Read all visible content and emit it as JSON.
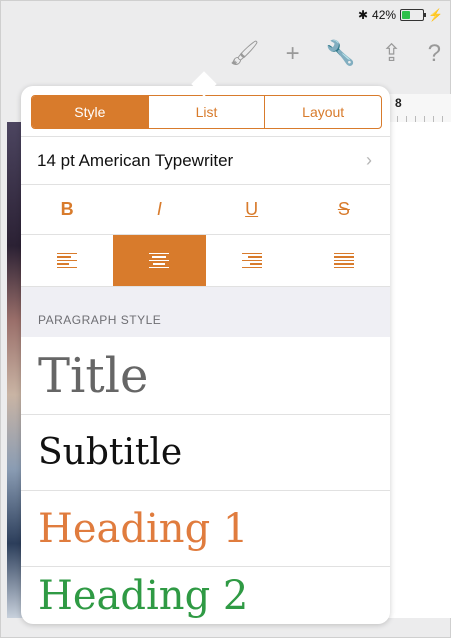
{
  "status": {
    "bluetooth_icon": "bluetooth-icon",
    "battery_percent": "42%",
    "battery_level": 0.42,
    "battery_color": "#2ec04a"
  },
  "toolbar": {
    "icons": [
      "paintbrush-icon",
      "plus-icon",
      "wrench-icon",
      "share-icon",
      "help-icon"
    ],
    "brush_glyph": "🖌",
    "plus_glyph": "+",
    "wrench_glyph": "🔧",
    "share_glyph": "⇪",
    "help_glyph": "?"
  },
  "ruler": {
    "number": "8"
  },
  "popover": {
    "tabs": [
      {
        "label": "Style",
        "active": true
      },
      {
        "label": "List",
        "active": false
      },
      {
        "label": "Layout",
        "active": false
      }
    ],
    "font_label": "14 pt American Typewriter",
    "chevron_icon": "chevron-right-icon",
    "chevron_glyph": "›",
    "text_styles": {
      "bold": "B",
      "italic": "I",
      "underline": "U",
      "strikethrough": "S"
    },
    "alignment": {
      "selected": "center",
      "options": [
        "left",
        "center",
        "right",
        "justify"
      ]
    },
    "section_header": "PARAGRAPH STYLE",
    "paragraph_styles": [
      {
        "label": "Title",
        "color": "#666666"
      },
      {
        "label": "Subtitle",
        "color": "#111111"
      },
      {
        "label": "Heading 1",
        "color": "#e07c3e"
      },
      {
        "label": "Heading 2",
        "color": "#2f9a44"
      }
    ]
  },
  "colors": {
    "accent": "#d87b2c"
  }
}
